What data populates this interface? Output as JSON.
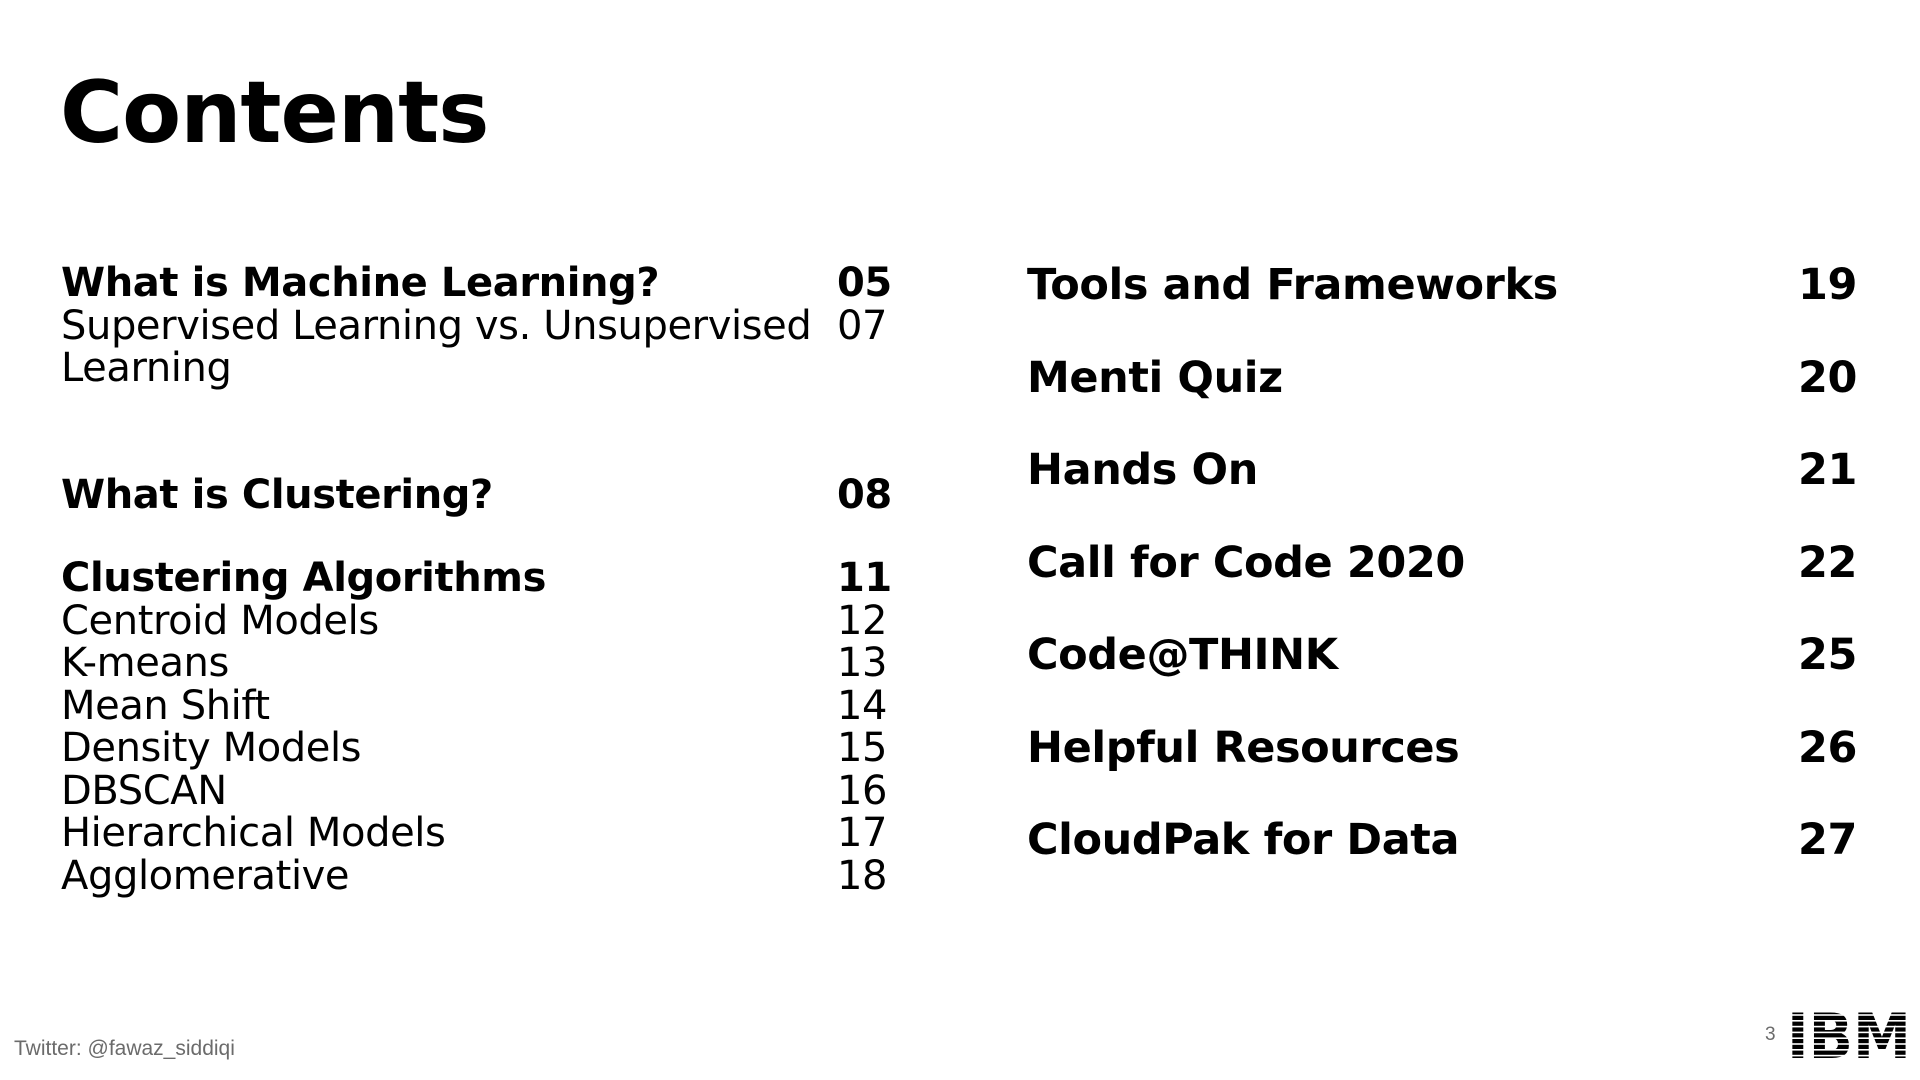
{
  "slide": {
    "title": "Contents",
    "left_items": [
      {
        "label": "What is Machine Learning?",
        "page": "05",
        "bold": true
      },
      {
        "label": "Supervised Learning vs. Unsupervised Learning",
        "page": "07",
        "bold": false
      },
      {
        "label": "What is Clustering?",
        "page": "08",
        "bold": true
      },
      {
        "label": "Clustering Algorithms",
        "page": "11",
        "bold": true
      },
      {
        "label": "Centroid Models",
        "page": "12",
        "bold": false
      },
      {
        "label": "K-means",
        "page": "13",
        "bold": false
      },
      {
        "label": "Mean Shift",
        "page": "14",
        "bold": false
      },
      {
        "label": "Density Models",
        "page": "15",
        "bold": false
      },
      {
        "label": "DBSCAN",
        "page": "16",
        "bold": false
      },
      {
        "label": "Hierarchical Models",
        "page": "17",
        "bold": false
      },
      {
        "label": "Agglomerative",
        "page": "18",
        "bold": false
      }
    ],
    "right_items": [
      {
        "label": "Tools and Frameworks",
        "page": "19"
      },
      {
        "label": "Menti Quiz",
        "page": "20"
      },
      {
        "label": "Hands On",
        "page": "21"
      },
      {
        "label": "Call for Code 2020",
        "page": "22"
      },
      {
        "label": "Code@THINK",
        "page": "25"
      },
      {
        "label": "Helpful Resources",
        "page": "26"
      },
      {
        "label": "CloudPak for Data",
        "page": "27"
      }
    ],
    "footer": {
      "twitter": "Twitter: @fawaz_siddiqi",
      "page_number": "3",
      "logo": "IBM"
    }
  },
  "colors": {
    "text": "#000000",
    "footer_text": "#6b6b6b",
    "background": "#ffffff"
  }
}
